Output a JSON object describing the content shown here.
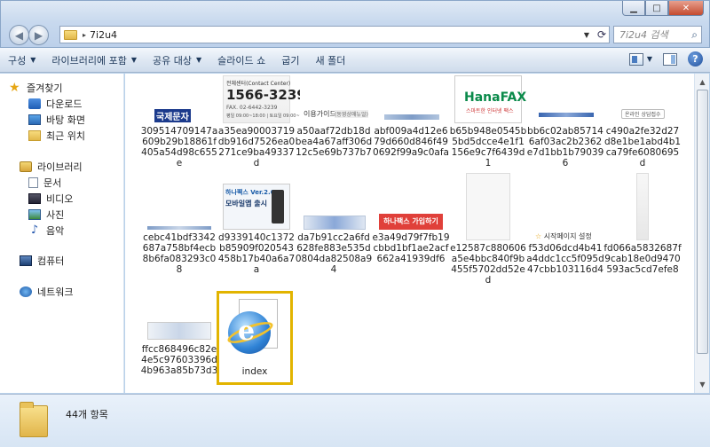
{
  "window": {
    "controls": {
      "minimize": "▁",
      "maximize": "□",
      "close": "✕"
    }
  },
  "nav": {
    "back": "◀",
    "forward": "▶"
  },
  "address": {
    "path": "7i2u4",
    "separator": "▸"
  },
  "search": {
    "placeholder": "7i2u4 검색"
  },
  "toolbar": {
    "organize": "구성",
    "include_library": "라이브러리에 포함",
    "share_with": "공유 대상",
    "slideshow": "슬라이드 쇼",
    "burn": "굽기",
    "new_folder": "새 폴더"
  },
  "sidebar": {
    "favorites": "즐겨찾기",
    "downloads": "다운로드",
    "desktop": "바탕 화면",
    "recent": "최근 위치",
    "libraries": "라이브러리",
    "documents": "문서",
    "videos": "비디오",
    "pictures": "사진",
    "music": "음악",
    "computer": "컴퓨터",
    "network": "네트워크"
  },
  "files": [
    {
      "name": "309514709147a609b29b18861f405a54d98c655e",
      "thumb_text": "국제문자"
    },
    {
      "name": "a35ea90003719db916d7526ea0271ce9ba49337d",
      "thumb_text": "1566-3239",
      "thumb_sub": "전체센터(Contact Center)",
      "thumb_sub2": "FAX. 02-6442-3239",
      "thumb_sub3": "평일 09:00~18:00 | 토요일 09:00~14:00"
    },
    {
      "name": "a50aaf72db18dbea4a67aff306d12c5e69b737b7",
      "thumb_text": "이용가이드",
      "thumb_sub": "(동영상매뉴얼)"
    },
    {
      "name": "abf009a4d12e679d660d846f490692f99a9c0afa",
      "thumb_text": ""
    },
    {
      "name": "b65b948e0545b5bd5dcce4e1f1156e9c7f6439d1",
      "thumb_text": "HanaFAX",
      "thumb_sub": "스마트한 인터넷 팩스"
    },
    {
      "name": "bb6c02ab857146af03ac2b2362e7d1bb1b790396",
      "thumb_text": ""
    },
    {
      "name": "c490a2fe32d27d8e1be1abd4b1ca79fe6080695d",
      "thumb_text": "온라인 상담접수"
    },
    {
      "name": "cebc41bdf3342687a758bf4ecb8b6fa083293c08",
      "thumb_text": ""
    },
    {
      "name": "d9339140c1372b85909f020543458b17b40a6a7a",
      "thumb_text": "하나팩스 Ver.2.6",
      "thumb_sub": "모바일앱 출시"
    },
    {
      "name": "da7b91cc2a6fd628fe883e535d0804da82508a94",
      "thumb_text": ""
    },
    {
      "name": "e3a49d79f7fb19cbbd1bf1ae2acf662a41939df6",
      "thumb_text": "하나팩스 가입하기"
    },
    {
      "name": "e12587c880606a5e4bbc840f9b455f5702dd52ed",
      "thumb_text": ""
    },
    {
      "name": "f53d06dcd4b41a4ddc1cc5f095d47cbb103116d4",
      "thumb_text": "시작페이지 설정"
    },
    {
      "name": "fd066a5832687f9cab18e0d9470593ac5cd7efe8",
      "thumb_text": ""
    },
    {
      "name": "ffcc868496c82e4e5c97603396d4b963a85b73d3",
      "thumb_text": ""
    },
    {
      "name": "index",
      "thumb_text": ""
    }
  ],
  "status": {
    "item_count": "44개 항목"
  },
  "colors": {
    "selection_border": "#e2b400",
    "accent": "#1e395b"
  }
}
